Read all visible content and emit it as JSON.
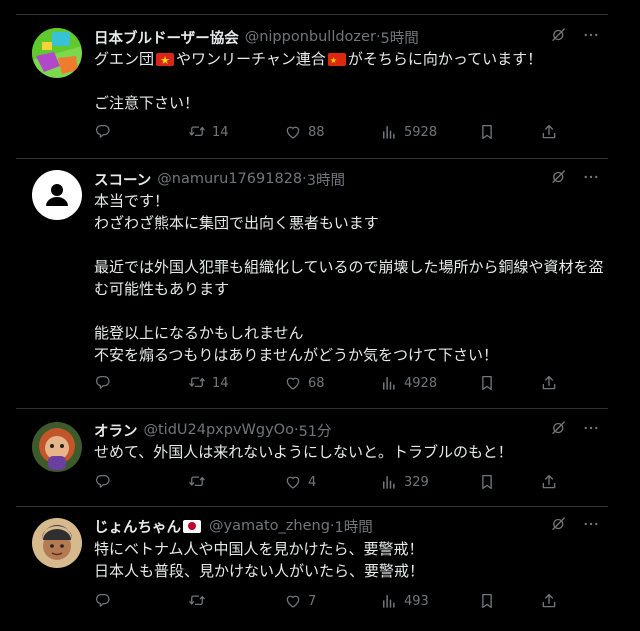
{
  "tweets": [
    {
      "name": "日本ブルドーザー協会",
      "handle": "@nipponbulldozer",
      "time": "5時間",
      "line1a": "グエン団",
      "line1b": "やワンリーチャン連合",
      "line1c": "がそちらに向かっています！",
      "line2": "ご注意下さい！",
      "retweets": "14",
      "likes": "88",
      "views": "5928"
    },
    {
      "name": "スコーン",
      "handle": "@namuru17691828",
      "time": "3時間",
      "lines": [
        "本当です！",
        "わざわざ熊本に集団で出向く悪者もいます",
        "最近では外国人犯罪も組織化しているので崩壊した場所から銅線や資材を盗",
        "む可能性もあります",
        "能登以上になるかもしれません",
        "不安を煽るつもりはありませんがどうか気をつけて下さい！"
      ],
      "retweets": "14",
      "likes": "68",
      "views": "4928"
    },
    {
      "name": "オラン",
      "handle": "@tidU24pxpvWgyOo",
      "time": "51分",
      "line1": "せめて、外国人は来れないようにしないと。トラブルのもと！",
      "likes": "4",
      "views": "329"
    },
    {
      "name": "じょんちゃん",
      "handle": "@yamato_zheng",
      "time": "1時間",
      "line1": "特にベトナム人や中国人を見かけたら、要警戒！",
      "line2": "日本人も普段、見かけない人がいたら、要警戒！",
      "likes": "7",
      "views": "493"
    }
  ],
  "separator": "·",
  "icons": [
    "grok-icon",
    "more-icon",
    "reply-icon",
    "retweet-icon",
    "like-icon",
    "views-icon",
    "bookmark-icon",
    "share-icon",
    "default-avatar-icon",
    "vietnam-flag-icon",
    "china-flag-icon",
    "japan-flag-icon"
  ]
}
